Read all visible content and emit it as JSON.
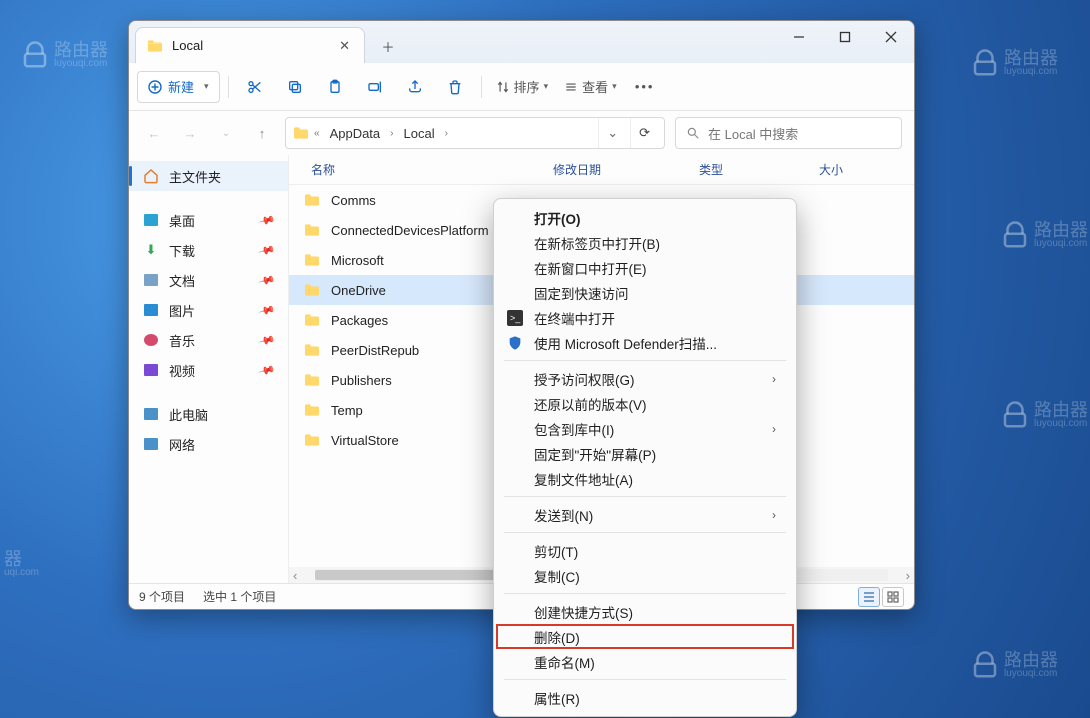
{
  "watermark": {
    "brand": "路由器",
    "domain": "luyouqi.com"
  },
  "tab": {
    "title": "Local"
  },
  "toolbar": {
    "new_label": "新建",
    "sort_label": "排序",
    "view_label": "查看"
  },
  "breadcrumbs": {
    "b1": "AppData",
    "b2": "Local"
  },
  "search": {
    "placeholder": "在 Local 中搜索"
  },
  "sidebar": {
    "home": "主文件夹",
    "desktop": "桌面",
    "downloads": "下载",
    "documents": "文档",
    "pictures": "图片",
    "music": "音乐",
    "videos": "视频",
    "thispc": "此电脑",
    "network": "网络"
  },
  "columns": {
    "name": "名称",
    "date": "修改日期",
    "type": "类型",
    "size": "大小"
  },
  "folders": [
    {
      "name": "Comms"
    },
    {
      "name": "ConnectedDevicesPlatform"
    },
    {
      "name": "Microsoft"
    },
    {
      "name": "OneDrive"
    },
    {
      "name": "Packages"
    },
    {
      "name": "PeerDistRepub"
    },
    {
      "name": "Publishers"
    },
    {
      "name": "Temp"
    },
    {
      "name": "VirtualStore"
    }
  ],
  "status": {
    "count": "9 个项目",
    "selected": "选中 1 个项目"
  },
  "context_menu": {
    "open": "打开(O)",
    "open_new_tab": "在新标签页中打开(B)",
    "open_new_window": "在新窗口中打开(E)",
    "pin_quick": "固定到快速访问",
    "open_terminal": "在终端中打开",
    "defender": "使用 Microsoft Defender扫描...",
    "grant_access": "授予访问权限(G)",
    "restore": "还原以前的版本(V)",
    "include_lib": "包含到库中(I)",
    "pin_start": "固定到\"开始\"屏幕(P)",
    "copy_path": "复制文件地址(A)",
    "send_to": "发送到(N)",
    "cut": "剪切(T)",
    "copy": "复制(C)",
    "shortcut": "创建快捷方式(S)",
    "delete": "删除(D)",
    "rename": "重命名(M)",
    "properties": "属性(R)"
  }
}
